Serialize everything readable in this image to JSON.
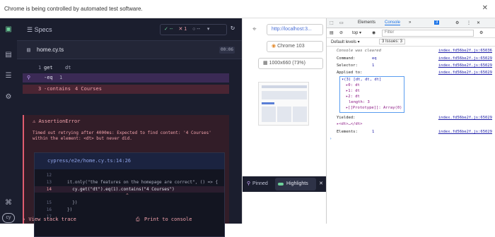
{
  "infobar": {
    "text": "Chrome is being controlled by automated test software.",
    "close": "✕"
  },
  "rail": {
    "icons": [
      "logo-icon",
      "runs-icon",
      "specs-list-icon",
      "settings-icon",
      "shortcuts-icon",
      "cypress-logo"
    ]
  },
  "runner": {
    "specs_label": "Specs",
    "passed": "✓ --",
    "failed": "✕ 1",
    "pending": "○ --",
    "file_name": "home.cy.ts",
    "duration": "00:06",
    "commands": [
      {
        "n": "1",
        "k": "get",
        "v": "dt"
      },
      {
        "n": "2",
        "k": "-eq",
        "v": "1"
      },
      {
        "n": "3",
        "k": "-contains",
        "v": "4 Courses"
      }
    ],
    "error_title": "AssertionError",
    "error_msg": "Timed out retrying after 4000ms: Expected to find content: '4 Courses' within the element: <dt> but never did.",
    "code_path": "cypress/e2e/home.cy.ts:14:26",
    "code_lines": [
      {
        "n": "12",
        "t": ""
      },
      {
        "n": "13",
        "t": "it.only(\"the features on the homepage are correct\", () => {"
      },
      {
        "n": "14",
        "t": "  cy.get(\"dt\").eq(1).contains(\"4 Courses\")",
        "hl": true
      },
      {
        "n": "",
        "t": "                       ^"
      },
      {
        "n": "15",
        "t": "  })"
      },
      {
        "n": "16",
        "t": "})"
      },
      {
        "n": "17",
        "t": ""
      }
    ],
    "view_stack": "› View stack trace",
    "print_console": "Print to console"
  },
  "aut": {
    "url": "http://localhost:3...",
    "browser": "Chrome 103",
    "viewport": "1000x660 (73%)",
    "pinned": "Pinned",
    "highlights": "Highlights"
  },
  "devtools": {
    "tabs": [
      "Elements",
      "Console",
      "»"
    ],
    "issues_badge": "3",
    "top": "top ▾",
    "filter_placeholder": "Filter",
    "levels": "Default levels ▾",
    "issues": "3 Issues: 3",
    "lines": [
      {
        "lbl": "Console was cleared",
        "val": "",
        "src": "index.fd56be2f.js:65036"
      },
      {
        "lbl": "Command:",
        "val": "eq",
        "src": "index.fd56be2f.js:65029"
      },
      {
        "lbl": "Selector:",
        "val": "1",
        "src": "index.fd56be2f.js:65029"
      },
      {
        "lbl": "Applied to:",
        "val": "",
        "src": "index.fd56be2f.js:65029"
      }
    ],
    "tree": [
      "▾(3) [dt, dt, dt]",
      "▸0: dt",
      "▸1: dt",
      "▸2: dt",
      "length: 3",
      "▸[[Prototype]]: Array(0)"
    ],
    "yielded": {
      "lbl": "Yielded:",
      "val": "▸<dt>…</dt>",
      "src": "index.fd56be2f.js:65029"
    },
    "elements": {
      "lbl": "Elements:",
      "val": "1",
      "src": "index.fd56be2f.js:65029"
    },
    "prompt": "›"
  }
}
